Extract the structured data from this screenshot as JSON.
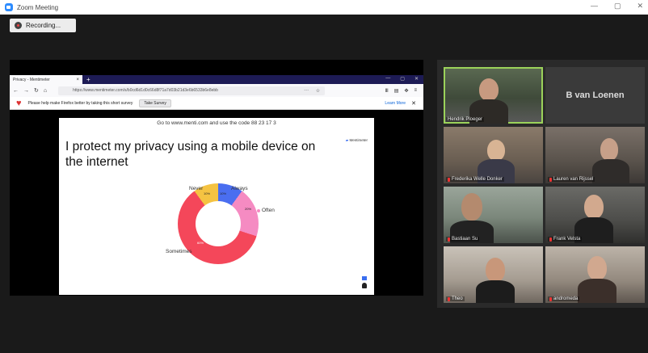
{
  "window": {
    "title": "Zoom Meeting",
    "controls": [
      "—",
      "▢",
      "✕"
    ]
  },
  "recording": {
    "label": "Recording..."
  },
  "browser": {
    "tab_title": "Privacy - Mentimeter",
    "tab_close": "×",
    "new_tab": "+",
    "url": "https://www.mentimeter.com/s/b0cd6d1d0c66d8f71a7d03b21d3e6b6533b6e8ebb",
    "page_actions": "···",
    "notification": {
      "message": "Please help make Firefox better by taking this short survey",
      "button": "Take Survey",
      "link": "Learn More",
      "close": "✕"
    }
  },
  "slide": {
    "code_line": "Go to www.menti.com and use the code 88 23 17 3",
    "logo": "Mentimeter",
    "question": "I protect my privacy using a mobile device on the internet",
    "legend": {
      "always": "Always",
      "often": "Often",
      "sometimes": "Sometimes",
      "never": "Never"
    },
    "percent_labels": {
      "always": "10%",
      "often": "20%",
      "sometimes": "60%",
      "never": "10%"
    },
    "colors": {
      "always": "#4a6ef0",
      "often": "#f58bc2",
      "sometimes": "#f4475a",
      "never": "#f5c342"
    }
  },
  "participants": [
    {
      "name": "Hendrik Ploeger",
      "active": true
    },
    {
      "name": "B van Loenen",
      "video": false
    },
    {
      "name": "Frederika Welle Donker"
    },
    {
      "name": "Lauren van Rijssel"
    },
    {
      "name": "Bastiaan Su"
    },
    {
      "name": "Frank Velsta"
    },
    {
      "name": "Theo"
    },
    {
      "name": "andromeda"
    }
  ]
}
